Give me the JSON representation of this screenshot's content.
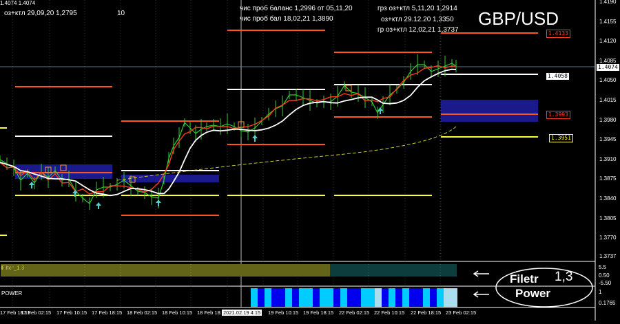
{
  "symbol": "GBP/USD",
  "top_left_price": "1.4074 1.4074",
  "annotations": {
    "left_note": "оз+ктл 29,09,20 1,2795",
    "left_note_suffix": "10",
    "center_line1": "чис проб баланс 1,2996 от 05,11,20",
    "center_line2": "чис проб бал 18,02,21  1,3890",
    "right_line1": "грз оз+ктл 5,11,20   1,2914",
    "right_line2": "оз+ктл 29.12.20  1,3350",
    "right_line3": "гр оз+ктл 12,02,21 1,3737"
  },
  "price_axis": {
    "ticks": [
      "1.4190",
      "1.4155",
      "1.4120",
      "1.4085",
      "1.4050",
      "1.4015",
      "1.3980",
      "1.3945",
      "1.3910",
      "1.3875",
      "1.3840",
      "1.3805",
      "1.3770",
      "1.3737"
    ],
    "current_price": "1.4074"
  },
  "level_labels": [
    {
      "text": "1.4133",
      "color": "#ff3a1a"
    },
    {
      "text": "1.4058",
      "color": "#ffffff"
    },
    {
      "text": "1.3993",
      "color": "#ff3a1a"
    },
    {
      "text": "1.3951",
      "color": "#ffff33"
    }
  ],
  "time_axis": [
    "17 Feb 18:15",
    "17 Feb 02:15",
    "17 Feb 10:15",
    "17 Feb 18:15",
    "18 Feb 02:15",
    "18 Feb 10:15",
    "18 Feb 18:15",
    "2021.02.19 4:15",
    "19 Feb 10:15",
    "19 Feb 18:15",
    "22 Feb 02:15",
    "22 Feb 10:15",
    "22 Feb 18:15",
    "23 Feb 02:15"
  ],
  "indicators": {
    "filter_name": "Filter_1.3",
    "filter_scale": [
      "5.5",
      "0.50",
      "-5.50"
    ],
    "power_name": "POWER",
    "power_scale": [
      "1",
      "0.1765"
    ]
  },
  "callouts": {
    "filter": "Filetr",
    "filter_value": "1,3",
    "power": "Power"
  },
  "colors": {
    "background": "#000000",
    "candles": "#33cc33",
    "ma_fast": "#ff3a1a",
    "ma_slow": "#ffffff",
    "support_line": "#ffff33",
    "zone": "#1a1a8c",
    "filter_bars": "#c8c830",
    "filter_bars_recent": "#1a7a7a",
    "power_blue": "#0000ee",
    "power_cyan": "#00ccff",
    "arrow": "#55cccc"
  }
}
